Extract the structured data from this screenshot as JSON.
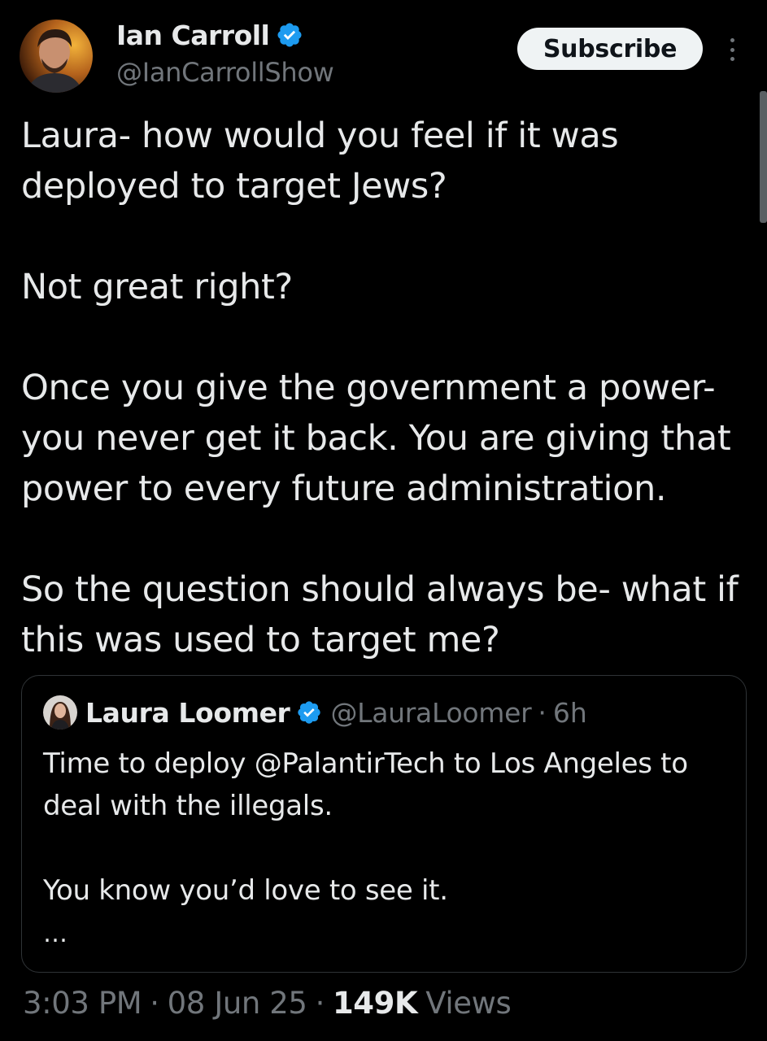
{
  "author": {
    "name": "Ian Carroll",
    "handle": "@IanCarrollShow",
    "verified_color": "#1d9bf0"
  },
  "header": {
    "subscribe_label": "Subscribe",
    "more_icon": "more-vertical-icon"
  },
  "tweet": {
    "paragraphs": [
      "Laura- how would you feel if it was deployed to target Jews?",
      "Not great right?",
      "Once you give the government a power- you never get it back. You are giving that power to every future administration.",
      "So the question should always be- what if this was used to target me?"
    ]
  },
  "quote": {
    "name": "Laura Loomer",
    "handle": "@LauraLoomer",
    "separator": "·",
    "time": "6h",
    "paragraphs": [
      "Time to deploy @PalantirTech to Los Angeles to deal with the illegals.",
      "You know you’d love to see it."
    ],
    "ellipsis": "…"
  },
  "meta": {
    "time": "3:03 PM",
    "separator": "·",
    "date": "08 Jun 25",
    "views_count": "149K",
    "views_label": "Views"
  },
  "colors": {
    "background": "#000000",
    "text": "#e7e9ea",
    "secondary": "#71767b",
    "border": "#2f3336",
    "accent": "#1d9bf0"
  }
}
